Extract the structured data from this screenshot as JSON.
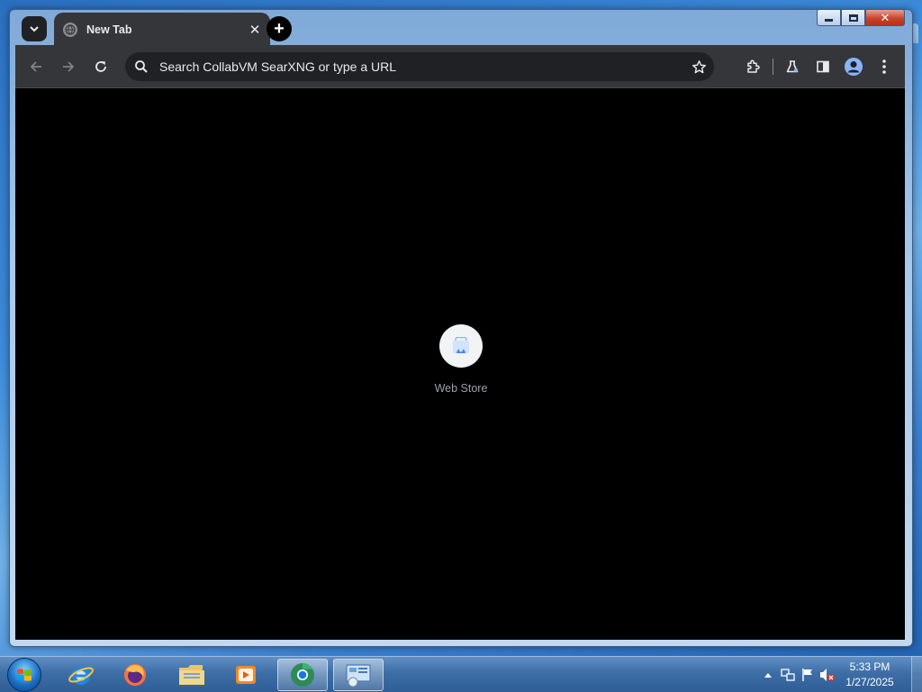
{
  "browser": {
    "tab": {
      "title": "New Tab",
      "close_symbol": "✕",
      "favicon": "globe-icon"
    },
    "new_tab_symbol": "+",
    "omnibox": {
      "placeholder": "Search CollabVM SearXNG or type a URL"
    },
    "toolbar_icons": [
      "back-arrow-icon",
      "forward-arrow-icon",
      "reload-icon",
      "search-icon",
      "star-icon",
      "extensions-icon",
      "labs-flask-icon",
      "side-panel-icon",
      "profile-icon",
      "menu-dots-icon"
    ],
    "window_controls": {
      "close_symbol": "✕"
    }
  },
  "new_tab_page": {
    "shortcuts": [
      {
        "label": "Web Store",
        "icon": "web-store-icon"
      }
    ],
    "background_color": "#000000"
  },
  "taskbar": {
    "apps": [
      "internet-explorer-icon",
      "firefox-icon",
      "file-explorer-icon",
      "media-player-icon",
      "chrome-icon",
      "control-panel-icon"
    ],
    "clock": {
      "time": "5:33 PM",
      "date": "1/27/2025"
    }
  },
  "colors": {
    "chrome_toolbar": "#35363a",
    "chrome_omnibox": "#202124",
    "text_light": "#e8eaed",
    "accent_blue": "#8ab4f8"
  }
}
